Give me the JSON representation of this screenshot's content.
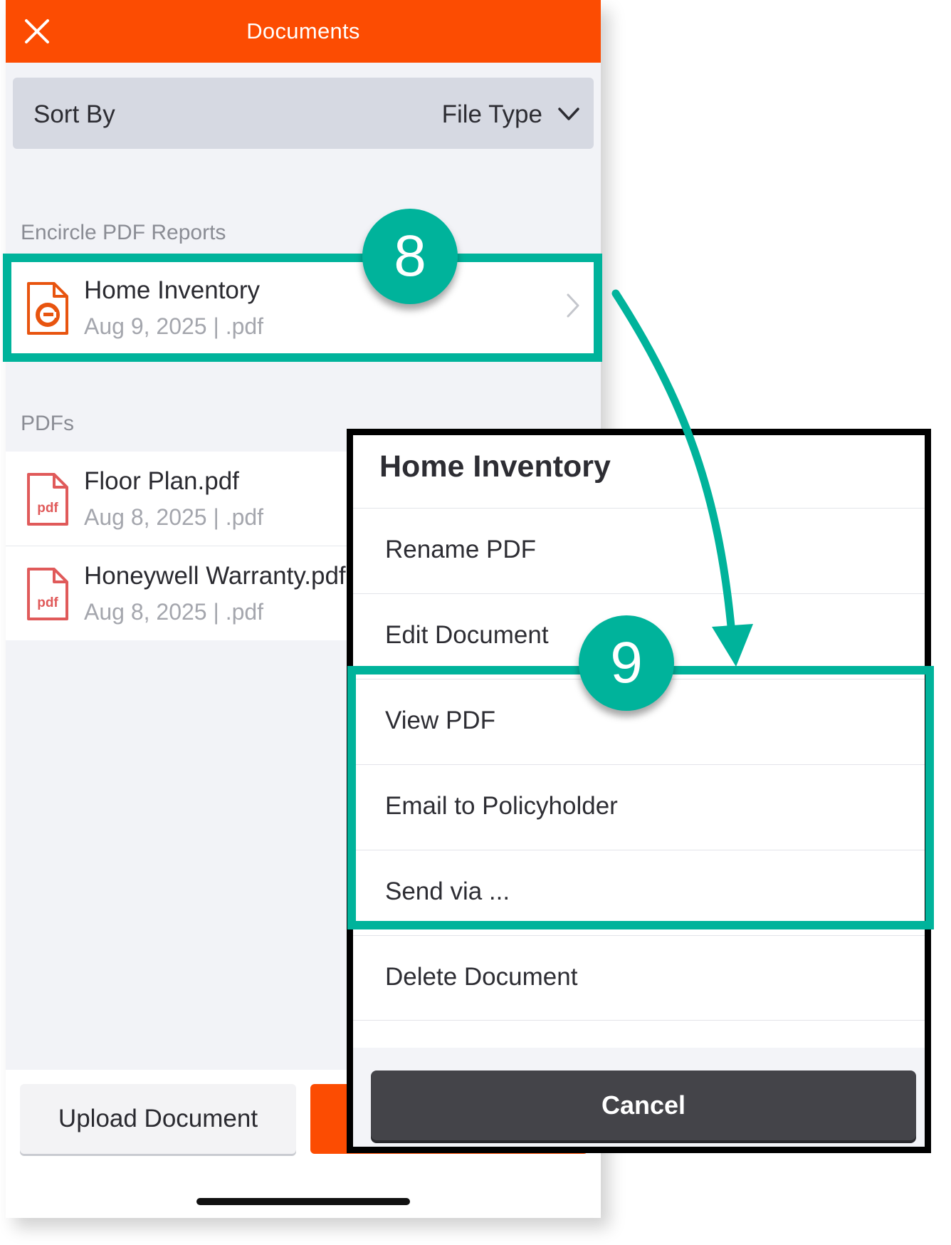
{
  "header": {
    "title": "Documents"
  },
  "sort": {
    "label": "Sort By",
    "value": "File Type"
  },
  "sections": {
    "reports_label": "Encircle PDF Reports",
    "pdfs_label": "PDFs"
  },
  "rows": [
    {
      "title": "Home Inventory",
      "meta": "Aug 9, 2025 | .pdf"
    },
    {
      "title": "Floor Plan.pdf",
      "meta": "Aug 8, 2025 | .pdf"
    },
    {
      "title": "Honeywell Warranty.pdf",
      "meta": "Aug 8, 2025 | .pdf"
    }
  ],
  "icons": {
    "pdf_label": "pdf"
  },
  "bottom": {
    "upload_label": "Upload Document"
  },
  "popup": {
    "title": "Home Inventory",
    "items": [
      "Rename PDF",
      "Edit Document",
      "View PDF",
      "Email to Policyholder",
      "Send via ...",
      "Delete Document"
    ],
    "cancel_label": "Cancel"
  },
  "annotations": {
    "step_a": "8",
    "step_b": "9"
  },
  "colors": {
    "brand": "#fc4c02",
    "highlight": "#00b39b",
    "cancel": "#444449"
  }
}
